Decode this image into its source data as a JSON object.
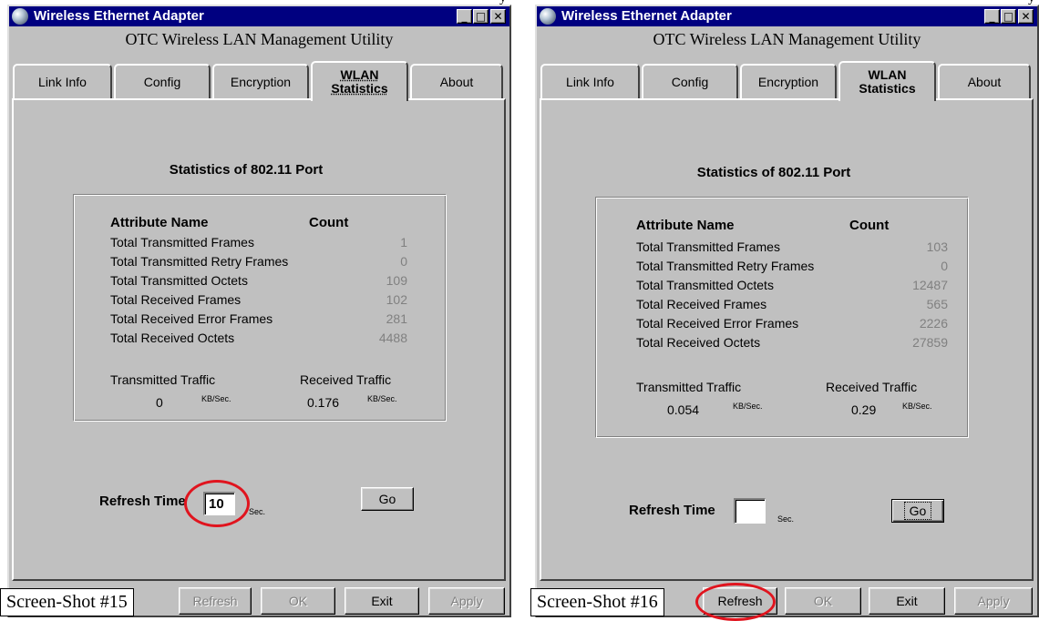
{
  "top_fragments": {
    "left": "y",
    "right": "y"
  },
  "screens": [
    {
      "window_title": "Wireless Ethernet Adapter",
      "utility_title": "OTC Wireless LAN Management Utility",
      "tabs": [
        "Link Info",
        "Config",
        "Encryption",
        "WLAN Statistics",
        "About"
      ],
      "active_tab": "WLAN Statistics",
      "stats_heading": "Statistics of 802.11 Port",
      "table_headers": {
        "name": "Attribute Name",
        "count": "Count"
      },
      "rows": [
        {
          "label": "Total Transmitted Frames",
          "count": "1"
        },
        {
          "label": "Total Transmitted Retry Frames",
          "count": "0"
        },
        {
          "label": "Total Transmitted Octets",
          "count": "109"
        },
        {
          "label": "Total Received Frames",
          "count": "102"
        },
        {
          "label": "Total Received Error Frames",
          "count": "281"
        },
        {
          "label": "Total Received Octets",
          "count": "4488"
        }
      ],
      "traffic": {
        "tx_label": "Transmitted Traffic",
        "rx_label": "Received Traffic",
        "tx_value": "0",
        "rx_value": "0.176",
        "unit": "KB/Sec."
      },
      "refresh": {
        "label": "Refresh Time",
        "value": "10",
        "unit": "Sec.",
        "go_label": "Go"
      },
      "buttons": {
        "refresh": "Refresh",
        "ok": "OK",
        "exit": "Exit",
        "apply": "Apply"
      },
      "caption": "Screen-Shot #15",
      "highlight_target": "refresh-time-input"
    },
    {
      "window_title": "Wireless Ethernet Adapter",
      "utility_title": "OTC Wireless LAN Management Utility",
      "tabs": [
        "Link Info",
        "Config",
        "Encryption",
        "WLAN Statistics",
        "About"
      ],
      "active_tab": "WLAN Statistics",
      "stats_heading": "Statistics of 802.11 Port",
      "table_headers": {
        "name": "Attribute Name",
        "count": "Count"
      },
      "rows": [
        {
          "label": "Total Transmitted Frames",
          "count": "103"
        },
        {
          "label": "Total Transmitted Retry Frames",
          "count": "0"
        },
        {
          "label": "Total Transmitted Octets",
          "count": "12487"
        },
        {
          "label": "Total Received Frames",
          "count": "565"
        },
        {
          "label": "Total Received Error Frames",
          "count": "2226"
        },
        {
          "label": "Total Received Octets",
          "count": "27859"
        }
      ],
      "traffic": {
        "tx_label": "Transmitted Traffic",
        "rx_label": "Received Traffic",
        "tx_value": "0.054",
        "rx_value": "0.29",
        "unit": "KB/Sec."
      },
      "refresh": {
        "label": "Refresh Time",
        "value": "",
        "unit": "Sec.",
        "go_label": "Go"
      },
      "buttons": {
        "refresh": "Refresh",
        "ok": "OK",
        "exit": "Exit",
        "apply": "Apply"
      },
      "caption": "Screen-Shot #16",
      "highlight_target": "refresh-button"
    }
  ],
  "colors": {
    "window_face": "#c0c0c0",
    "titlebar": "#000080",
    "disabled_text": "#808080",
    "highlight_ring": "#e0141e"
  },
  "icons": {
    "app": "network-adapter-icon",
    "minimize": "minimize-icon",
    "maximize": "maximize-icon",
    "close": "close-icon"
  }
}
